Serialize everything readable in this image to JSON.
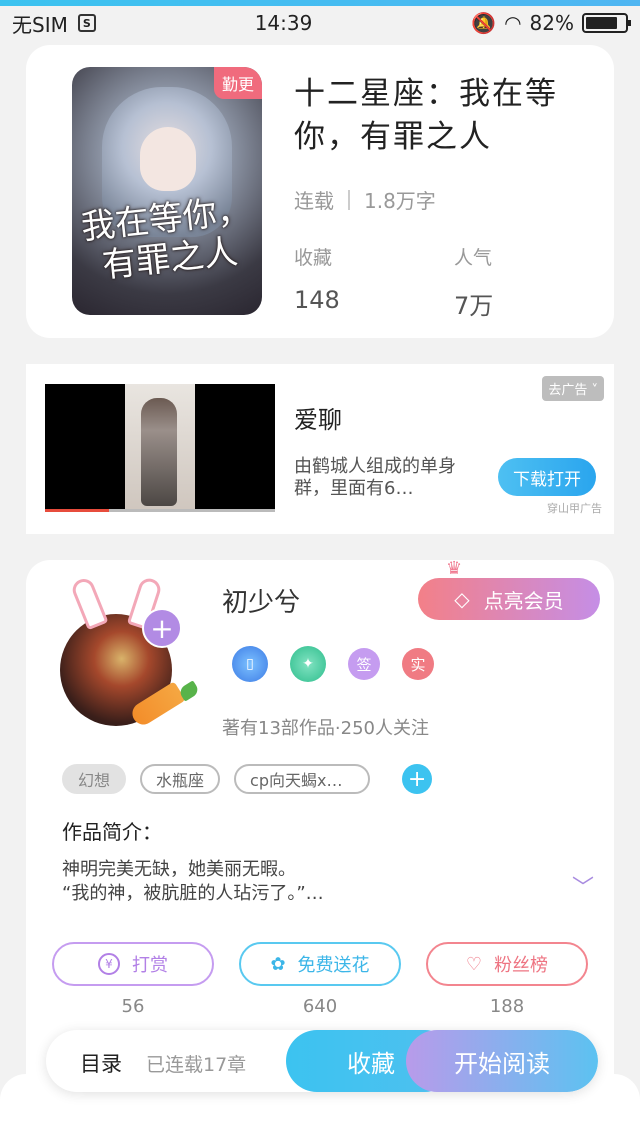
{
  "status_bar": {
    "carrier": "无SIM",
    "time": "14:39",
    "battery": "82%",
    "battery_level": 0.82
  },
  "book": {
    "cover_tag": "勤更",
    "cover_title": "我在等你，有罪之人",
    "title": "十二星座：我在等你，有罪之人",
    "status": "连载",
    "word_count": "1.8万字",
    "favorites_label": "收藏",
    "favorites_value": "148",
    "popularity_label": "人气",
    "popularity_value": "7万"
  },
  "ad": {
    "close_label": "去广告",
    "title": "爱聊",
    "description": "由鹤城人组成的单身群，里面有6…",
    "button": "下载打开",
    "source": "穿山甲广告",
    "progress": 0.28
  },
  "author": {
    "name": "初少兮",
    "vip_button": "点亮会员",
    "badges": [
      "签",
      "实"
    ],
    "stats": "著有13部作品·250人关注"
  },
  "tags": [
    "幻想",
    "水瓶座",
    "cp向天蝎x…"
  ],
  "intro": {
    "label": "作品简介：",
    "text": "神明完美无缺，她美丽无暇。\n“我的神，被肮脏的人玷污了。”…"
  },
  "actions": [
    {
      "label": "打赏",
      "icon": "¥",
      "count": "56"
    },
    {
      "label": "免费送花",
      "icon": "flower-icon",
      "count": "640"
    },
    {
      "label": "粉丝榜",
      "icon": "fans-icon",
      "count": "188"
    }
  ],
  "bottom_bar": {
    "toc": "目录",
    "chapters": "已连载17章",
    "favorite": "收藏",
    "read": "开始阅读"
  }
}
